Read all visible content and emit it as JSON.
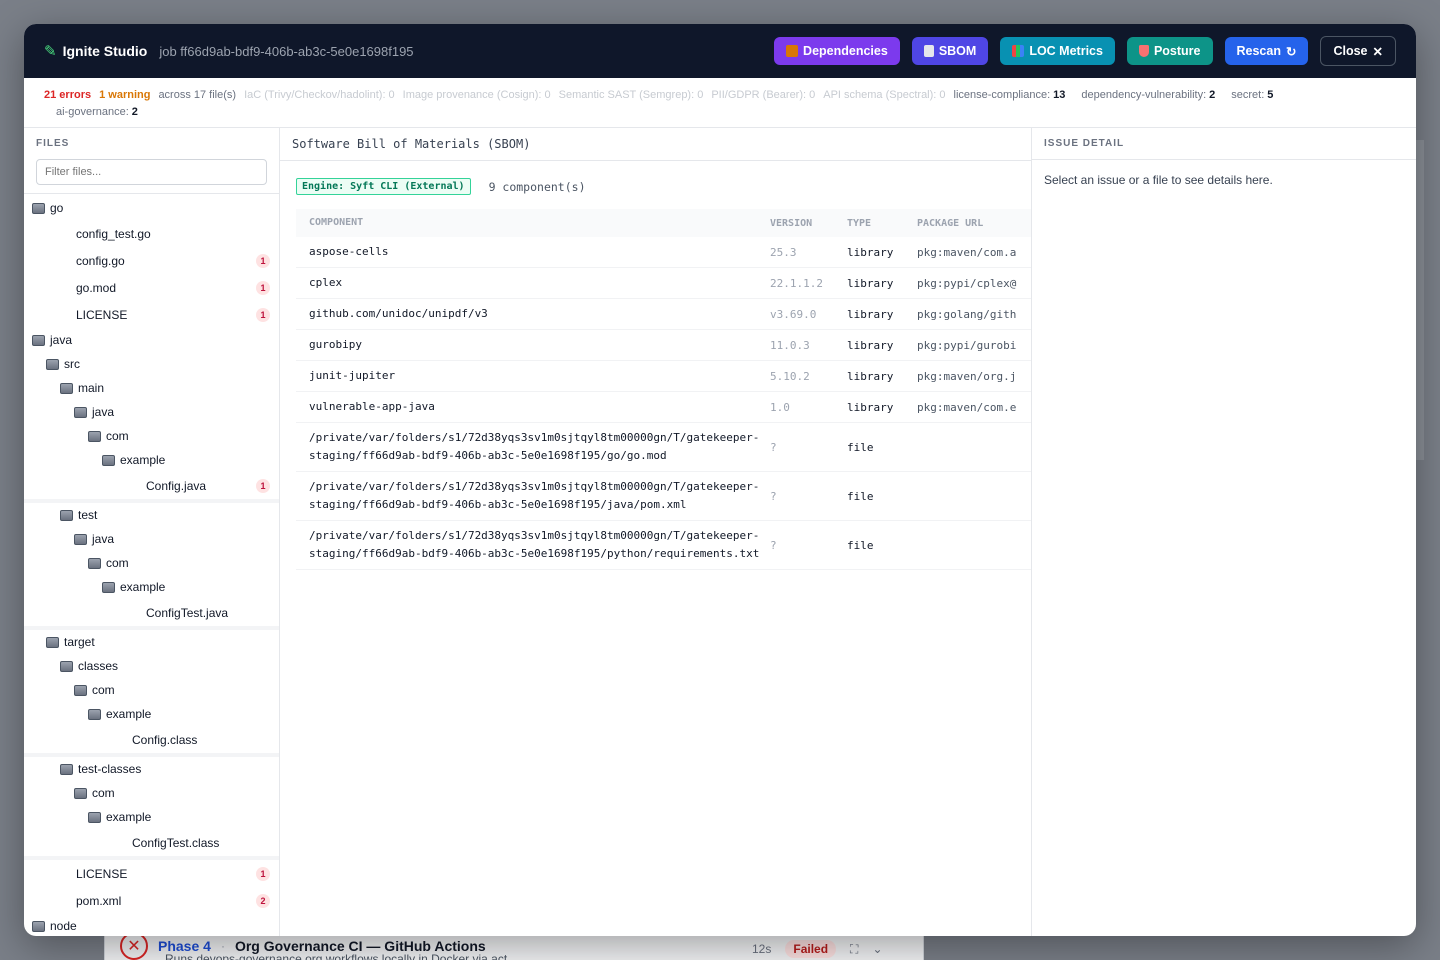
{
  "background": {
    "phase": "Phase 4",
    "sep": "·",
    "title": "Org Governance CI — GitHub Actions",
    "subtitle": "Runs devops-governance org workflows locally in Docker via act",
    "duration": "12s",
    "status": "Failed"
  },
  "header": {
    "brand": "Ignite Studio",
    "job": "job ff66d9ab-bdf9-406b-ab3c-5e0e1698f195",
    "buttons": {
      "dependencies": "Dependencies",
      "sbom": "SBOM",
      "loc": "LOC Metrics",
      "posture": "Posture",
      "rescan": "Rescan",
      "close": "Close"
    },
    "icons": {
      "rescan": "↻",
      "close": "✕"
    }
  },
  "summary": {
    "errors": "21 errors",
    "warnings": "1 warning",
    "files": "across 17 file(s)",
    "iac": "IaC (Trivy/Checkov/hadolint): 0",
    "provenance": "Image provenance (Cosign): 0",
    "sast": "Semantic SAST (Semgrep): 0",
    "pii": "PII/GDPR (Bearer): 0",
    "api": "API schema (Spectral): 0",
    "license_label": "license-compliance:",
    "license_count": "13",
    "depvuln_label": "dependency-vulnerability:",
    "depvuln_count": "2",
    "secret_label": "secret:",
    "secret_count": "5",
    "aigov_label": "ai-governance:",
    "aigov_count": "2"
  },
  "sidebar": {
    "heading": "FILES",
    "filter_placeholder": "Filter files...",
    "tree": [
      {
        "label": "go",
        "type": "folder",
        "depth": 0
      },
      {
        "label": "config_test.go",
        "type": "file",
        "depth": 1
      },
      {
        "label": "config.go",
        "type": "file",
        "depth": 1,
        "badge": "1"
      },
      {
        "label": "go.mod",
        "type": "file",
        "depth": 1,
        "badge": "1"
      },
      {
        "label": "LICENSE",
        "type": "file",
        "depth": 1,
        "badge": "1"
      },
      {
        "label": "java",
        "type": "folder",
        "depth": 0
      },
      {
        "label": "src",
        "type": "folder",
        "depth": 1
      },
      {
        "label": "main",
        "type": "folder",
        "depth": 2
      },
      {
        "label": "java",
        "type": "folder",
        "depth": 3
      },
      {
        "label": "com",
        "type": "folder",
        "depth": 4
      },
      {
        "label": "example",
        "type": "folder",
        "depth": 5
      },
      {
        "label": "Config.java",
        "type": "file",
        "depth": 6,
        "badge": "1"
      },
      {
        "label": "test",
        "type": "folder",
        "depth": 2
      },
      {
        "label": "java",
        "type": "folder",
        "depth": 3
      },
      {
        "label": "com",
        "type": "folder",
        "depth": 4
      },
      {
        "label": "example",
        "type": "folder",
        "depth": 5
      },
      {
        "label": "ConfigTest.java",
        "type": "file",
        "depth": 6
      },
      {
        "label": "target",
        "type": "folder",
        "depth": 1
      },
      {
        "label": "classes",
        "type": "folder",
        "depth": 2
      },
      {
        "label": "com",
        "type": "folder",
        "depth": 3
      },
      {
        "label": "example",
        "type": "folder",
        "depth": 4
      },
      {
        "label": "Config.class",
        "type": "file",
        "depth": 5
      },
      {
        "label": "test-classes",
        "type": "folder",
        "depth": 2
      },
      {
        "label": "com",
        "type": "folder",
        "depth": 3
      },
      {
        "label": "example",
        "type": "folder",
        "depth": 4
      },
      {
        "label": "ConfigTest.class",
        "type": "file",
        "depth": 5
      },
      {
        "label": "LICENSE",
        "type": "file",
        "depth": 1,
        "badge": "1"
      },
      {
        "label": "pom.xml",
        "type": "file",
        "depth": 1,
        "badge": "2"
      },
      {
        "label": "node",
        "type": "folder",
        "depth": 0
      }
    ]
  },
  "main": {
    "title": "Software Bill of Materials (SBOM)",
    "engine": "Engine: Syft CLI (External)",
    "count": "9 component(s)",
    "columns": [
      "COMPONENT",
      "VERSION",
      "TYPE",
      "PACKAGE URL"
    ],
    "rows": [
      {
        "component": "aspose-cells",
        "version": "25.3",
        "type": "library",
        "purl": "pkg:maven/com.a"
      },
      {
        "component": "cplex",
        "version": "22.1.1.2",
        "type": "library",
        "purl": "pkg:pypi/cplex@"
      },
      {
        "component": "github.com/unidoc/unipdf/v3",
        "version": "v3.69.0",
        "type": "library",
        "purl": "pkg:golang/gith"
      },
      {
        "component": "gurobipy",
        "version": "11.0.3",
        "type": "library",
        "purl": "pkg:pypi/gurobi"
      },
      {
        "component": "junit-jupiter",
        "version": "5.10.2",
        "type": "library",
        "purl": "pkg:maven/org.j"
      },
      {
        "component": "vulnerable-app-java",
        "version": "1.0",
        "type": "library",
        "purl": "pkg:maven/com.e"
      },
      {
        "component": "/private/var/folders/s1/72d38yqs3sv1m0sjtqyl8tm00000gn/T/gatekeeper-staging/ff66d9ab-bdf9-406b-ab3c-5e0e1698f195/go/go.mod",
        "version": "?",
        "type": "file",
        "purl": ""
      },
      {
        "component": "/private/var/folders/s1/72d38yqs3sv1m0sjtqyl8tm00000gn/T/gatekeeper-staging/ff66d9ab-bdf9-406b-ab3c-5e0e1698f195/java/pom.xml",
        "version": "?",
        "type": "file",
        "purl": ""
      },
      {
        "component": "/private/var/folders/s1/72d38yqs3sv1m0sjtqyl8tm00000gn/T/gatekeeper-staging/ff66d9ab-bdf9-406b-ab3c-5e0e1698f195/python/requirements.txt",
        "version": "?",
        "type": "file",
        "purl": ""
      }
    ]
  },
  "detail": {
    "heading": "ISSUE DETAIL",
    "text": "Select an issue or a file to see details here."
  },
  "colors": {
    "header_bg": "#0f172a",
    "dependencies": "#7c3aed",
    "sbom": "#4f46e5",
    "loc": "#0891b2",
    "posture": "#0d9488",
    "rescan": "#2563eb",
    "error": "#dc2626",
    "warning": "#d97706"
  }
}
